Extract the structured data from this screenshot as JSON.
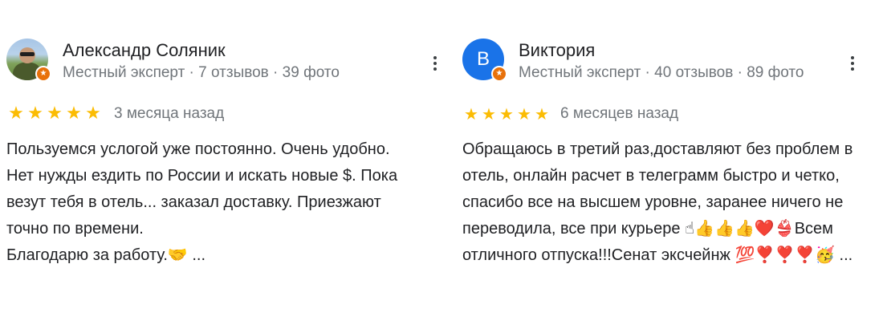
{
  "reviews": [
    {
      "author": "Александр Соляник",
      "meta": "Местный эксперт · 7 отзывов · 39 фото",
      "avatar": {
        "type": "photo-avatar",
        "letter": ""
      },
      "badge_icon": "local-guide-star-icon",
      "rating": 5,
      "stars": [
        "★",
        "★",
        "★",
        "★",
        "★"
      ],
      "date": "3 месяца назад",
      "text": "Пользуемся услогой уже постоянно. Очень удобно.\nНет нужды ездить по России и искать новые $. Пока\nвезут тебя в отель... заказал доставку. Приезжают\nточно по времени.\nБлагодарю за работу.🤝 ...",
      "menu_icon": "more-vert-icon"
    },
    {
      "author": "Виктория",
      "meta": "Местный эксперт · 40 отзывов · 89 фото",
      "avatar": {
        "type": "letter-avatar",
        "letter": "В",
        "color": "#1a73e8"
      },
      "badge_icon": "local-guide-star-icon",
      "rating": 5,
      "stars": [
        "★",
        "★",
        "★",
        "★",
        "★"
      ],
      "date": "6 месяцев назад",
      "text": "Обращаюсь в третий раз,доставляют без проблем в\nотель, онлайн расчет в телеграмм быстро и четко,\nспасибо все на высшем уровне, заранее ничего не\nпереводила, все при курьере ☝👍👍👍❤️👙Всем\nотличного отпуска!!!Сенат эксчейнж 💯❣️❣️❣️🥳 ...",
      "menu_icon": "more-vert-icon"
    }
  ],
  "colors": {
    "star": "#fbbc04",
    "badge": "#e8710a",
    "meta_text": "#70757a",
    "body_text": "#202124"
  }
}
